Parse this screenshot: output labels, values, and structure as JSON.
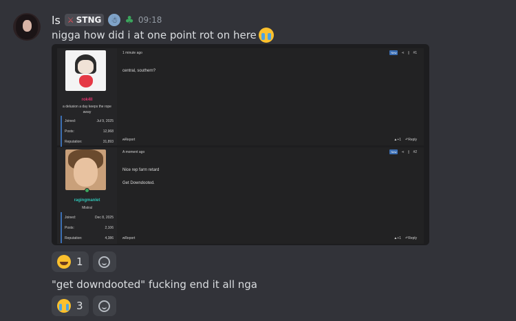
{
  "message": {
    "author": "ls",
    "tag": {
      "icon": "sword-icon",
      "label": "STNG"
    },
    "badges": [
      "snowman-badge",
      "clover-badge"
    ],
    "time": "09:18",
    "text1": "nigga how did i at one point rot on here",
    "text2": "\"get downdooted\" fucking end it all nga"
  },
  "embed": {
    "posts": [
      {
        "username": "rok4ll",
        "user_title": "a delusion a day keeps the rope away",
        "joined_label": "Joined:",
        "joined": "Jul 9, 2025",
        "posts_label": "Posts:",
        "posts": "12,968",
        "rep_label": "Reputation:",
        "rep": "31,893",
        "time": "1 minute ago",
        "new": "New",
        "number": "#1",
        "lines": [
          "central, southern?"
        ],
        "report": "Report",
        "plus": "+1",
        "reply": "Reply"
      },
      {
        "username": "ragingmanlet",
        "user_title": "Mistral",
        "joined_label": "Joined:",
        "joined": "Dec 8, 2025",
        "posts_label": "Posts:",
        "posts": "2,106",
        "rep_label": "Reputation:",
        "rep": "4,386",
        "time": "A moment ago",
        "new": "New",
        "number": "#2",
        "lines": [
          "Nice rep farm retard",
          "Get Downdooted."
        ],
        "report": "Report",
        "plus": "+1",
        "reply": "Reply"
      }
    ]
  },
  "reactions1": [
    {
      "emoji": "laughing-crying-emoji",
      "count": "1"
    }
  ],
  "reactions2": [
    {
      "emoji": "crying-emoji",
      "count": "3"
    }
  ]
}
